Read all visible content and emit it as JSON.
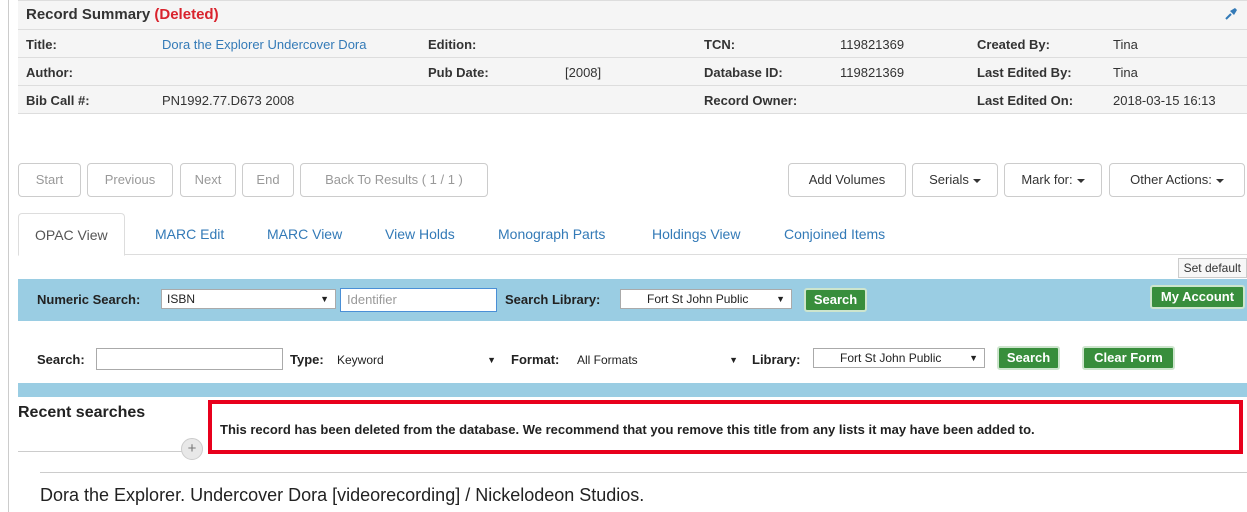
{
  "summary": {
    "title": "Record Summary",
    "status": "(Deleted)",
    "labels": {
      "title": "Title:",
      "edition": "Edition:",
      "tcn": "TCN:",
      "created_by": "Created By:",
      "author": "Author:",
      "pub_date": "Pub Date:",
      "database_id": "Database ID:",
      "last_edited_by": "Last Edited By:",
      "bib_call": "Bib Call #:",
      "record_owner": "Record Owner:",
      "last_edited_on": "Last Edited On:"
    },
    "values": {
      "title": "Dora the Explorer Undercover Dora",
      "tcn": "119821369",
      "created_by": "Tina",
      "pub_date": "[2008]",
      "database_id": "119821369",
      "last_edited_by": "Tina",
      "bib_call": "PN1992.77.D673 2008",
      "last_edited_on": "2018-03-15 16:13"
    }
  },
  "toolbar": {
    "start": "Start",
    "previous": "Previous",
    "next": "Next",
    "end": "End",
    "back": "Back To Results ( 1 / 1 )",
    "add_volumes": "Add Volumes",
    "serials": "Serials",
    "mark_for": "Mark for:",
    "other_actions": "Other Actions:"
  },
  "tabs": [
    "OPAC View",
    "MARC Edit",
    "MARC View",
    "View Holds",
    "Monograph Parts",
    "Holdings View",
    "Conjoined Items"
  ],
  "set_default": "Set default",
  "numeric_search": {
    "label": "Numeric Search:",
    "type_value": "ISBN",
    "placeholder": "Identifier",
    "library_label": "Search Library:",
    "library_value": "Fort St John Public",
    "search_button": "Search",
    "my_account": "My Account"
  },
  "search": {
    "label": "Search:",
    "type_label": "Type:",
    "type_value": "Keyword",
    "format_label": "Format:",
    "format_value": "All Formats",
    "library_label": "Library:",
    "library_value": "Fort St John Public",
    "search_button": "Search",
    "clear_button": "Clear Form"
  },
  "recent_searches": "Recent searches",
  "alert": "This record has been deleted from the database. We recommend that you remove this title from any lists it may have been added to.",
  "record_title": "Dora the Explorer. Undercover Dora [videorecording] / Nickelodeon Studios.",
  "colors": {
    "deleted": "#d9232d",
    "search_bar": "#9acde3",
    "alert_border": "#e8001c",
    "green_button": "#388e3c"
  }
}
